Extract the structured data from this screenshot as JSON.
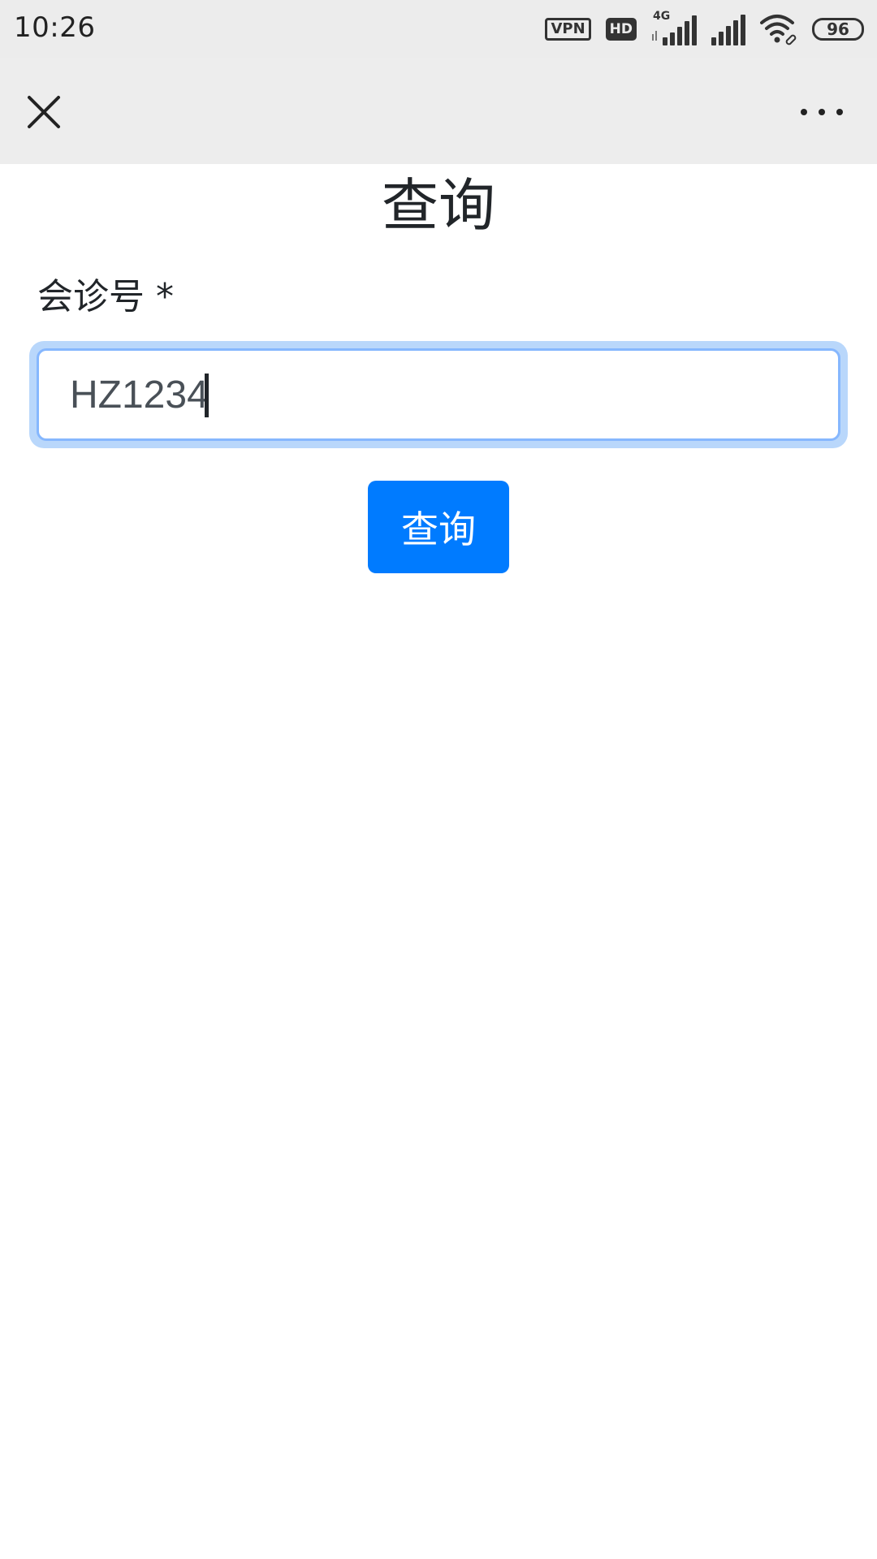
{
  "status_bar": {
    "time": "10:26",
    "vpn_label": "VPN",
    "hd_label": "HD",
    "network_label": "4G",
    "battery_level": "96",
    "icons": [
      "vpn-icon",
      "hd-icon",
      "signal-4g-icon",
      "signal-icon",
      "wifi-icon",
      "battery-icon"
    ]
  },
  "nav": {
    "close_icon": "close-icon",
    "more_icon": "more-icon"
  },
  "page": {
    "title": "查询",
    "field_label": "会诊号 *",
    "input_value": "HZ1234",
    "submit_label": "查询"
  },
  "colors": {
    "primary_button": "#007bff",
    "focus_ring": "#b9d7fb",
    "focus_border": "#86b7fe",
    "header_bg": "#ededed"
  }
}
